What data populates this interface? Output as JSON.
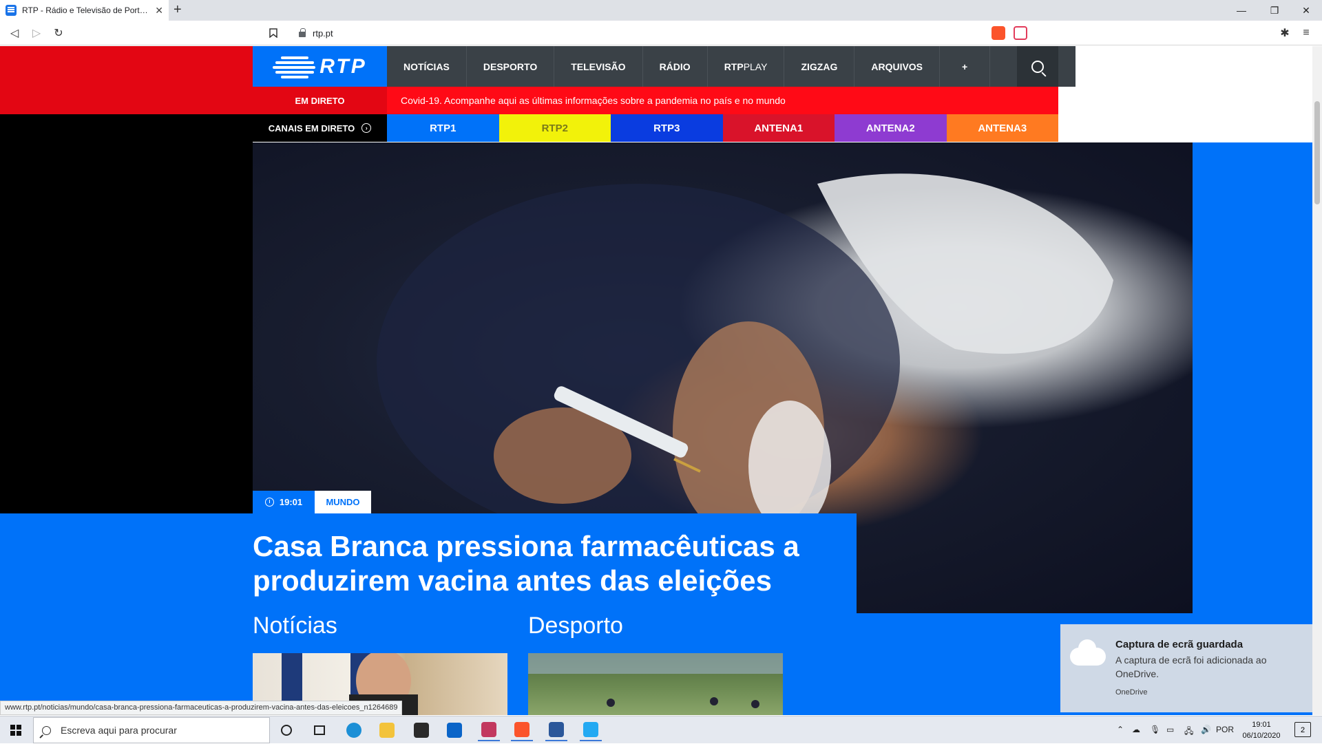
{
  "browser": {
    "tab_title": "RTP - Rádio e Televisão de Portugal",
    "tab_close": "✕",
    "new_tab": "+",
    "url": "rtp.pt",
    "window_controls": {
      "minimize": "—",
      "restore": "❐",
      "close": "✕"
    },
    "nav_icons": {
      "back": "◁",
      "forward": "▷",
      "reload": "↻",
      "bookmark": "🔖",
      "extensions": "✱",
      "menu": "≡"
    },
    "status_url": "www.rtp.pt/noticias/mundo/casa-branca-pressiona-farmaceuticas-a-produzirem-vacina-antes-das-eleicoes_n1264689"
  },
  "site": {
    "logo_text": "RTP",
    "nav": [
      {
        "label": "NOTÍCIAS"
      },
      {
        "label": "DESPORTO"
      },
      {
        "label": "TELEVISÃO"
      },
      {
        "label": "RÁDIO"
      },
      {
        "label": "RTP",
        "label_light": "PLAY"
      },
      {
        "label": "ZIGZAG"
      },
      {
        "label": "ARQUIVOS"
      },
      {
        "label": "+"
      }
    ],
    "live_label": "EM DIRETO",
    "ticker": "Covid-19. Acompanhe aqui as últimas informações sobre a pandemia no país e no mundo",
    "channels_label": "CANAIS EM DIRETO",
    "channels_arrow": "›",
    "channels": [
      {
        "label": "RTP1",
        "bg": "#0072f9",
        "fg": "#ffffff"
      },
      {
        "label": "RTP2",
        "bg": "#f2f20a",
        "fg": "#7a7a1a"
      },
      {
        "label": "RTP3",
        "bg": "#0a3ce0",
        "fg": "#ffffff"
      },
      {
        "label": "ANTENA1",
        "bg": "#d9132a",
        "fg": "#ffffff"
      },
      {
        "label": "ANTENA2",
        "bg": "#8e3bd1",
        "fg": "#ffffff"
      },
      {
        "label": "ANTENA3",
        "bg": "#ff7a21",
        "fg": "#ffffff"
      }
    ],
    "article": {
      "time": "19:01",
      "category": "MUNDO",
      "headline": "Casa Branca pressiona farmacêuticas a produzirem vacina antes das eleições"
    },
    "sections": {
      "news": "Notícias",
      "sport": "Desporto"
    },
    "colors": {
      "brand_blue": "#0072f9",
      "brand_red": "#e30613",
      "nav_dark": "#3a4147"
    }
  },
  "toast": {
    "title": "Captura de ecrã guardada",
    "body": "A captura de ecrã foi adicionada ao OneDrive.",
    "source": "OneDrive"
  },
  "taskbar": {
    "search_placeholder": "Escreva aqui para procurar",
    "language": "POR",
    "time": "19:01",
    "date": "06/10/2020",
    "notifications": "2",
    "apps": [
      "cortana-icon",
      "task-view-icon",
      "edge-icon",
      "file-explorer-icon",
      "store-icon",
      "mail-icon",
      "teams-icon",
      "brave-icon",
      "word-icon",
      "vscode-icon"
    ]
  }
}
